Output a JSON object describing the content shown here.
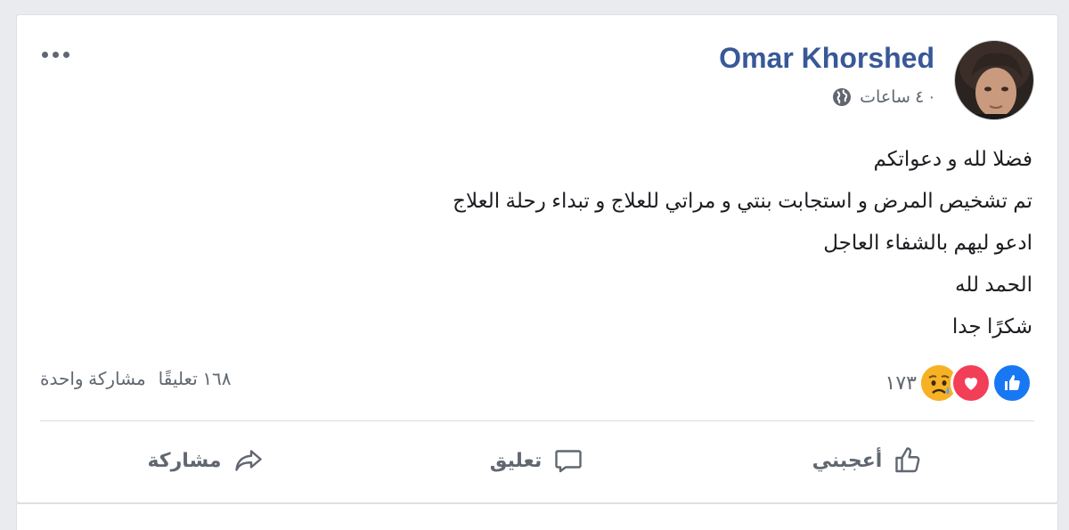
{
  "post": {
    "author": "Omar Khorshed",
    "time": "٤ ساعات ·",
    "lines": [
      "فضلا لله و دعواتكم",
      "تم تشخيص المرض و استجابت بنتي و مراتي للعلاج و تبداء رحلة العلاج",
      "ادعو ليهم بالشفاء العاجل",
      "الحمد لله",
      "شكرًا جدا"
    ]
  },
  "stats": {
    "reactions_count": "١٧٣",
    "comments": "١٦٨ تعليقًا",
    "shares": "مشاركة واحدة"
  },
  "actions": {
    "like": "أعجبني",
    "comment": "تعليق",
    "share": "مشاركة"
  },
  "icons": {
    "reactions": [
      "like-reaction-icon",
      "love-reaction-icon",
      "sad-reaction-icon"
    ],
    "privacy": "globe-icon",
    "more": "more-options-icon"
  },
  "colors": {
    "author": "#385898",
    "like": "#1877f2",
    "love": "#f33e58",
    "sad": "#f7b125",
    "text": "#1c1e21",
    "muted": "#606770"
  }
}
